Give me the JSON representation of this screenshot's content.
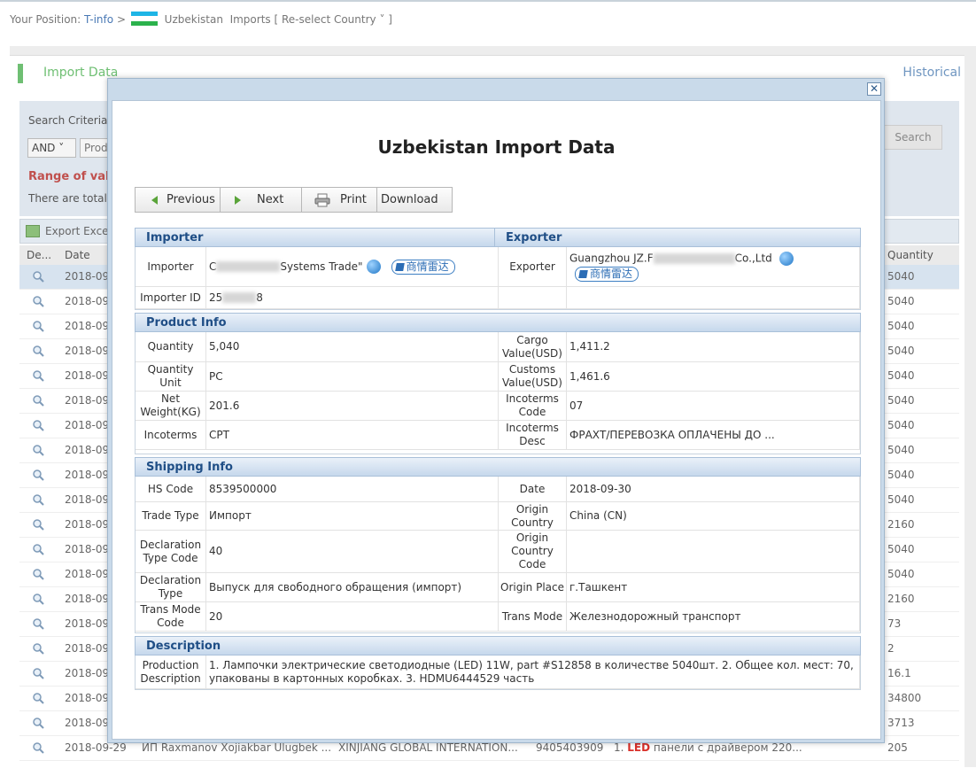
{
  "breadcrumb": {
    "prefix": "Your Position:",
    "tinfo": "T-info",
    "sep": ">",
    "country": "Uzbekistan",
    "section": "Imports",
    "reselect": "[ Re-select Country ˅ ]"
  },
  "page": {
    "import_title": "Import Data",
    "historical": "Historical",
    "search_criteria": "Search Criteria",
    "and_select": "AND ˅",
    "prod_select": "Prod",
    "range": "Range of vali",
    "total": "There are total",
    "search_button": "Search",
    "export_excel": "Export Exce",
    "col_detail": "De...",
    "col_date": "Date",
    "col_quantity": "Quantity"
  },
  "rows": [
    {
      "date": "2018-09",
      "qty": "5040"
    },
    {
      "date": "2018-09",
      "qty": "5040"
    },
    {
      "date": "2018-09",
      "qty": "5040"
    },
    {
      "date": "2018-09",
      "qty": "5040"
    },
    {
      "date": "2018-09",
      "qty": "5040"
    },
    {
      "date": "2018-09",
      "qty": "5040"
    },
    {
      "date": "2018-09",
      "qty": "5040"
    },
    {
      "date": "2018-09",
      "qty": "5040"
    },
    {
      "date": "2018-09",
      "qty": "5040"
    },
    {
      "date": "2018-09",
      "qty": "5040"
    },
    {
      "date": "2018-09",
      "qty": "2160"
    },
    {
      "date": "2018-09",
      "qty": "5040"
    },
    {
      "date": "2018-09",
      "qty": "5040"
    },
    {
      "date": "2018-09",
      "qty": "2160"
    },
    {
      "date": "2018-09",
      "qty": "73"
    },
    {
      "date": "2018-09",
      "qty": "2"
    },
    {
      "date": "2018-09",
      "qty": "16.1"
    },
    {
      "date": "2018-09",
      "qty": "34800"
    },
    {
      "date": "2018-09",
      "qty": "3713"
    }
  ],
  "last_row": {
    "date": "2018-09-29",
    "importer": "ИП Raxmanov Xojiakbar Ulugbek ...",
    "exporter": "XINJIANG GLOBAL INTERNATION...",
    "hs": "9405403909",
    "desc_prefix": "1.",
    "desc_led": "LED",
    "desc_rest": "панели с драйвером 220...",
    "qty": "205"
  },
  "modal": {
    "close": "✕",
    "title": "Uzbekistan Import Data",
    "toolbar": {
      "previous": "Previous",
      "next": "Next",
      "print": "Print",
      "download": "Download"
    },
    "parties": {
      "importer_head": "Importer",
      "exporter_head": "Exporter",
      "importer_label": "Importer",
      "importer_value_start": "C",
      "importer_value_end": "Systems Trade\"",
      "radar_label": "商情雷达",
      "exporter_label": "Exporter",
      "exporter_value_start": "Guangzhou JZ.F",
      "exporter_value_end": "Co.,Ltd",
      "importer_id_label": "Importer ID",
      "importer_id_start": "25",
      "importer_id_end": "8"
    },
    "product": {
      "head": "Product Info",
      "rows": [
        {
          "l1": "Quantity",
          "v1": "5,040",
          "l2": "Cargo Value(USD)",
          "v2": "1,411.2"
        },
        {
          "l1": "Quantity Unit",
          "v1": "PC",
          "l2": "Customs Value(USD)",
          "v2": "1,461.6"
        },
        {
          "l1": "Net Weight(KG)",
          "v1": "201.6",
          "l2": "Incoterms Code",
          "v2": "07"
        },
        {
          "l1": "Incoterms",
          "v1": "CPT",
          "l2": "Incoterms Desc",
          "v2": "ФРАХТ/ПЕРЕВОЗКА ОПЛАЧЕНЫ ДО ..."
        }
      ]
    },
    "shipping": {
      "head": "Shipping Info",
      "rows": [
        {
          "l1": "HS Code",
          "v1": "8539500000",
          "l2": "Date",
          "v2": "2018-09-30"
        },
        {
          "l1": "Trade Type",
          "v1": "Импорт",
          "l2": "Origin Country",
          "v2": "China (CN)"
        },
        {
          "l1": "Declaration Type Code",
          "v1": "40",
          "l2": "Origin Country Code",
          "v2": ""
        },
        {
          "l1": "Declaration Type",
          "v1": "Выпуск для свободного обращения (импорт)",
          "l2": "Origin Place",
          "v2": "г.Ташкент"
        },
        {
          "l1": "Trans Mode Code",
          "v1": "20",
          "l2": "Trans Mode",
          "v2": "Железнодорожный транспорт"
        }
      ]
    },
    "description": {
      "head": "Description",
      "label": "Production Description",
      "value": "1. Лампочки электрические светодиодные (LED) 11W, part #S12858 в количестве 5040шт. 2. Общее кол. мест: 70, упакованы в картонных коробках. 3. HDMU6444529 часть"
    }
  },
  "colors": {
    "accent_green": "#6fbf73",
    "link_blue": "#4a79b5",
    "section_head_text": "#1f4e86",
    "range_red": "#c0504d",
    "flag": [
      "#1eb5e6",
      "#ffffff",
      "#2bb24c"
    ]
  }
}
